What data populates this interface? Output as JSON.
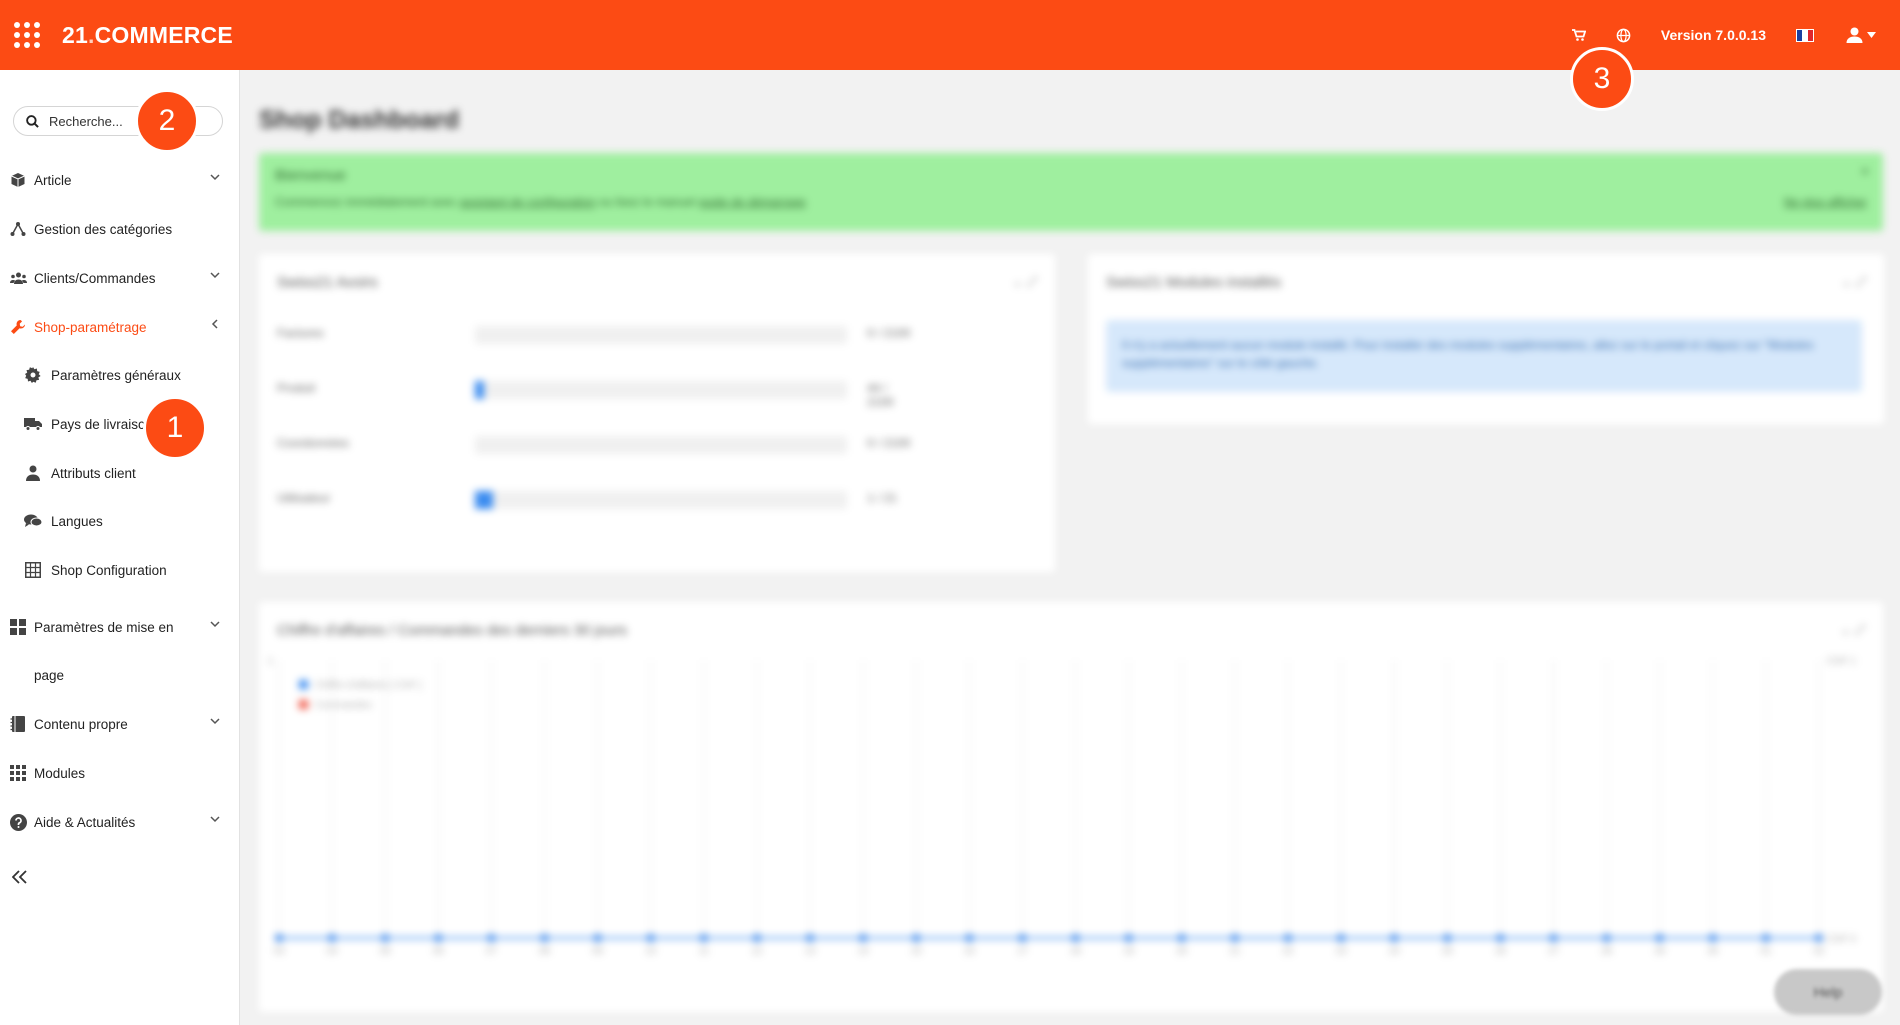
{
  "topbar": {
    "logo_main": "21",
    "logo_dot": ".",
    "logo_brand": "COMMERCE",
    "version": "Version 7.0.0.13",
    "icons": [
      "cart-icon",
      "globe-icon",
      "user-icon"
    ],
    "flag_colors": [
      "#1a3fa0",
      "#ffffff",
      "#e0262b"
    ]
  },
  "sidebar": {
    "search_placeholder": "Recherche...",
    "items": [
      {
        "label": "Article",
        "icon": "box-icon",
        "chevron": "down"
      },
      {
        "label": "Gestion des catégories",
        "icon": "tree-icon"
      },
      {
        "label": "Clients/Commandes",
        "icon": "users-icon",
        "chevron": "down"
      },
      {
        "label": "Shop-paramétrage",
        "icon": "wrench-icon",
        "chevron": "left",
        "active": true
      },
      {
        "label": "Paramètres généraux",
        "icon": "gear-icon",
        "sub": true
      },
      {
        "label": "Pays de livraisc",
        "icon": "truck-icon",
        "sub": true
      },
      {
        "label": "Attributs client",
        "icon": "user-icon",
        "sub": true
      },
      {
        "label": "Langues",
        "icon": "chat-icon",
        "sub": true
      },
      {
        "label": "Shop Configuration",
        "icon": "grid-table-icon",
        "sub": true
      },
      {
        "label": "Paramètres de mise en",
        "label2": "page",
        "icon": "layout-icon",
        "chevron": "down"
      },
      {
        "label": "Contenu propre",
        "icon": "book-icon",
        "chevron": "down"
      },
      {
        "label": "Modules",
        "icon": "modules-icon"
      },
      {
        "label": "Aide & Actualités",
        "icon": "question-icon",
        "chevron": "down"
      }
    ]
  },
  "main": {
    "title": "Shop Dashboard",
    "alert": {
      "title": "Bienvenue",
      "text_before": "Commencez immédiatement avec ",
      "link1": "assistant de configuration",
      "text_mid": " ou lisez le manuel ",
      "link2": "guide de démarrage",
      "dismiss": "Ne plus afficher",
      "close": "×"
    },
    "panel_quota": {
      "title": "Swiss21 Avoirs",
      "rows": [
        {
          "label": "Factures",
          "value": "0 / 2100",
          "fill": 0.0
        },
        {
          "label": "Produit",
          "value": "44 / 2100",
          "fill": 0.021
        },
        {
          "label": "Coordonnées",
          "value": "0 / 2100",
          "fill": 0.0
        },
        {
          "label": "Utilisateur",
          "value": "1 / 21",
          "fill": 0.048
        }
      ]
    },
    "panel_modules": {
      "title": "Swiss21 Modules installés",
      "info": "Il n'y a actuellement aucun module installé. Pour installer des modules supplémentaires, allez sur le portail et cliquez sur \"Modules supplémentaires\" sur le côté gauche."
    },
    "panel_chart": {
      "title": "Chiffre d'affaires / Commandes des derniers 30 jours"
    },
    "help_label": "Help"
  },
  "chart_data": {
    "type": "line",
    "title": "Chiffre d'affaires / Commandes des derniers 30 jours",
    "x": [
      "03",
      "04",
      "05",
      "06",
      "07",
      "08",
      "09",
      "10",
      "11",
      "12",
      "13",
      "14",
      "15",
      "16",
      "17",
      "18",
      "19",
      "20",
      "21",
      "22",
      "23",
      "24",
      "25",
      "26",
      "27",
      "28",
      "29",
      "30",
      "01",
      "02"
    ],
    "series": [
      {
        "name": "Chiffre d'affaires [ CHF ]",
        "color": "#3b8cf0",
        "values": [
          0,
          0,
          0,
          0,
          0,
          0,
          0,
          0,
          0,
          0,
          0,
          0,
          0,
          0,
          0,
          0,
          0,
          0,
          0,
          0,
          0,
          0,
          0,
          0,
          0,
          0,
          0,
          0,
          0,
          0
        ]
      },
      {
        "name": "Commandes",
        "color": "#f05a4a",
        "values": [
          0,
          0,
          0,
          0,
          0,
          0,
          0,
          0,
          0,
          0,
          0,
          0,
          0,
          0,
          0,
          0,
          0,
          0,
          0,
          0,
          0,
          0,
          0,
          0,
          0,
          0,
          0,
          0,
          0,
          0
        ]
      }
    ],
    "y_left_top": "1",
    "y_right_top": "CHF 1",
    "y_right_bottom": "CHF 0",
    "legend": "top-left",
    "grid": true
  },
  "badges": [
    "1",
    "2",
    "3"
  ]
}
